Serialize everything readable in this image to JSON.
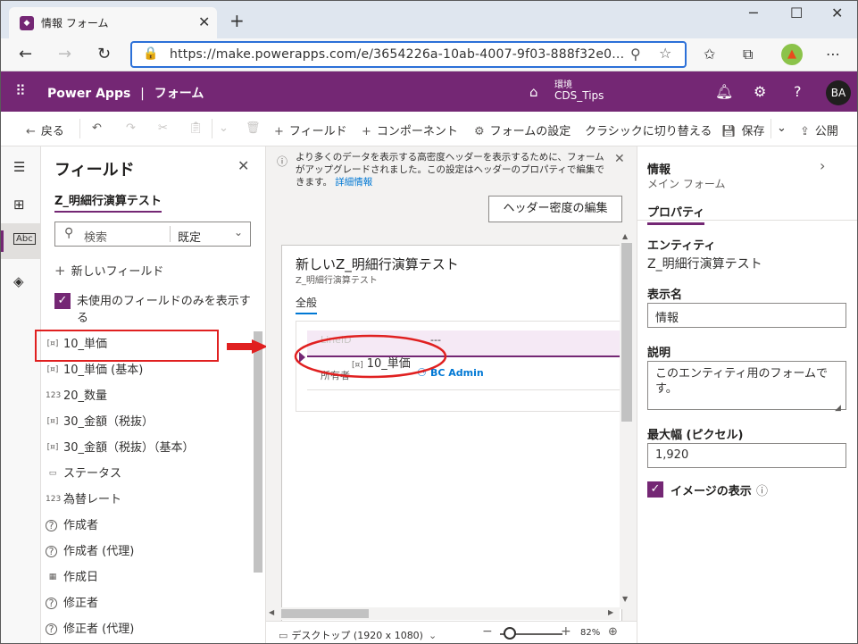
{
  "browser": {
    "tab_title": "情報 フォーム",
    "url": "https://make.powerapps.com/e/3654226a-10ab-4007-9f03-888f32e0..."
  },
  "app": {
    "brand": "Power Apps",
    "separator": "|",
    "section": "フォーム",
    "env_label": "環境",
    "env_value": "CDS_Tips",
    "user_initials": "BA"
  },
  "commands": {
    "back": "戻る",
    "add_field": "フィールド",
    "add_component": "コンポーネント",
    "form_settings": "フォームの設定",
    "classic": "クラシックに切り替える",
    "save": "保存",
    "publish": "公開"
  },
  "fields_panel": {
    "title": "フィールド",
    "entity": "Z_明細行演算テスト",
    "search_placeholder": "検索",
    "filter_value": "既定",
    "new_field": "新しいフィールド",
    "unused_only": "未使用のフィールドのみを表示する",
    "items": [
      {
        "label": "10_単価",
        "icon": "currency-icon"
      },
      {
        "label": "10_単価 (基本)",
        "icon": "currency-icon"
      },
      {
        "label": "20_数量",
        "icon": "number-icon"
      },
      {
        "label": "30_金額（税抜）",
        "icon": "currency-icon"
      },
      {
        "label": "30_金額（税抜）（基本）",
        "icon": "currency-icon"
      },
      {
        "label": "ステータス",
        "icon": "option-set-icon"
      },
      {
        "label": "為替レート",
        "icon": "number-icon"
      },
      {
        "label": "作成者",
        "icon": "lookup-icon"
      },
      {
        "label": "作成者 (代理)",
        "icon": "lookup-icon"
      },
      {
        "label": "作成日",
        "icon": "calendar-icon"
      },
      {
        "label": "修正者",
        "icon": "lookup-icon"
      },
      {
        "label": "修正者 (代理)",
        "icon": "lookup-icon"
      }
    ]
  },
  "canvas": {
    "info_text": "より多くのデータを表示する高密度ヘッダーを表示するために、フォームがアップグレードされました。この設定はヘッダーのプロパティで編集できます。",
    "info_link": "詳細情報",
    "header_button": "ヘッダー密度の編集",
    "form_title": "新しいZ_明細行演算テスト",
    "form_subtitle": "Z_明細行演算テスト",
    "form_tab": "全般",
    "row1_label": "LineID",
    "row1_value": "---",
    "row2_label": "所有者",
    "row2_value": "BC Admin",
    "drag_label": "10_単価",
    "device": "デスクトップ (1920 x 1080)",
    "zoom": "82%"
  },
  "properties": {
    "title": "情報",
    "subtitle": "メイン フォーム",
    "tab": "プロパティ",
    "entity_label": "エンティティ",
    "entity_value": "Z_明細行演算テスト",
    "display_name_label": "表示名",
    "display_name_value": "情報",
    "description_label": "説明",
    "description_value": "このエンティティ用のフォームです。",
    "max_width_label": "最大幅 (ピクセル)",
    "max_width_value": "1,920",
    "show_image_label": "イメージの表示"
  },
  "colors": {
    "brand": "#742774",
    "accent": "#0078d4",
    "annotation": "#e02020"
  }
}
